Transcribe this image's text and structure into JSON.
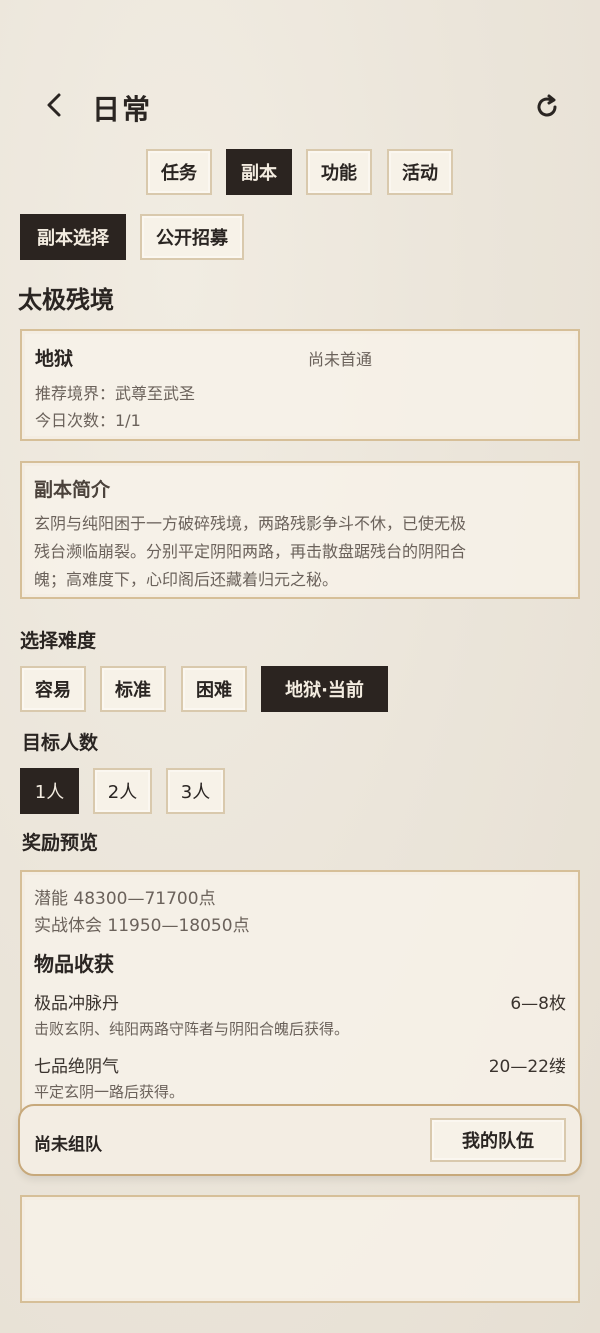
{
  "header": {
    "title": "日常"
  },
  "top_tabs": [
    {
      "label": "任务",
      "active": false
    },
    {
      "label": "副本",
      "active": true
    },
    {
      "label": "功能",
      "active": false
    },
    {
      "label": "活动",
      "active": false
    }
  ],
  "sub_tabs": [
    {
      "label": "副本选择",
      "active": true
    },
    {
      "label": "公开招募",
      "active": false
    }
  ],
  "dungeon": {
    "name": "太极残境",
    "difficulty_card": {
      "title": "地狱",
      "status": "尚未首通",
      "recommend": "推荐境界：武尊至武圣",
      "today_count": "今日次数：1/1"
    },
    "intro": {
      "title": "副本简介",
      "lines": [
        "玄阴与纯阳困于一方破碎残境，两路残影争斗不休，已使无极",
        "残台濒临崩裂。分别平定阴阳两路，再击散盘踞残台的阴阳合",
        "魄；高难度下，心印阁后还藏着归元之秘。"
      ]
    }
  },
  "difficulty": {
    "title": "选择难度",
    "options": [
      {
        "label": "容易",
        "active": false
      },
      {
        "label": "标准",
        "active": false
      },
      {
        "label": "困难",
        "active": false
      },
      {
        "label": "地狱·当前",
        "active": true
      }
    ]
  },
  "team_size": {
    "title": "目标人数",
    "options": [
      {
        "label": "1人",
        "active": true
      },
      {
        "label": "2人",
        "active": false
      },
      {
        "label": "3人",
        "active": false
      }
    ]
  },
  "rewards": {
    "title": "奖励预览",
    "potential": "潜能 48300—71700点",
    "experience": "实战体会 11950—18050点",
    "items_title": "物品收获",
    "items": [
      {
        "name": "极品冲脉丹",
        "qty": "6—8枚",
        "desc": "击败玄阴、纯阳两路守阵者与阴阳合魄后获得。"
      },
      {
        "name": "七品绝阴气",
        "qty": "20—22缕",
        "desc": "平定玄阴一路后获得。"
      }
    ]
  },
  "team_bar": {
    "status": "尚未组队",
    "button": "我的队伍"
  },
  "colors": {
    "dark": "#2b2420",
    "border": "#d6bf98",
    "background": "#ebe5da"
  }
}
